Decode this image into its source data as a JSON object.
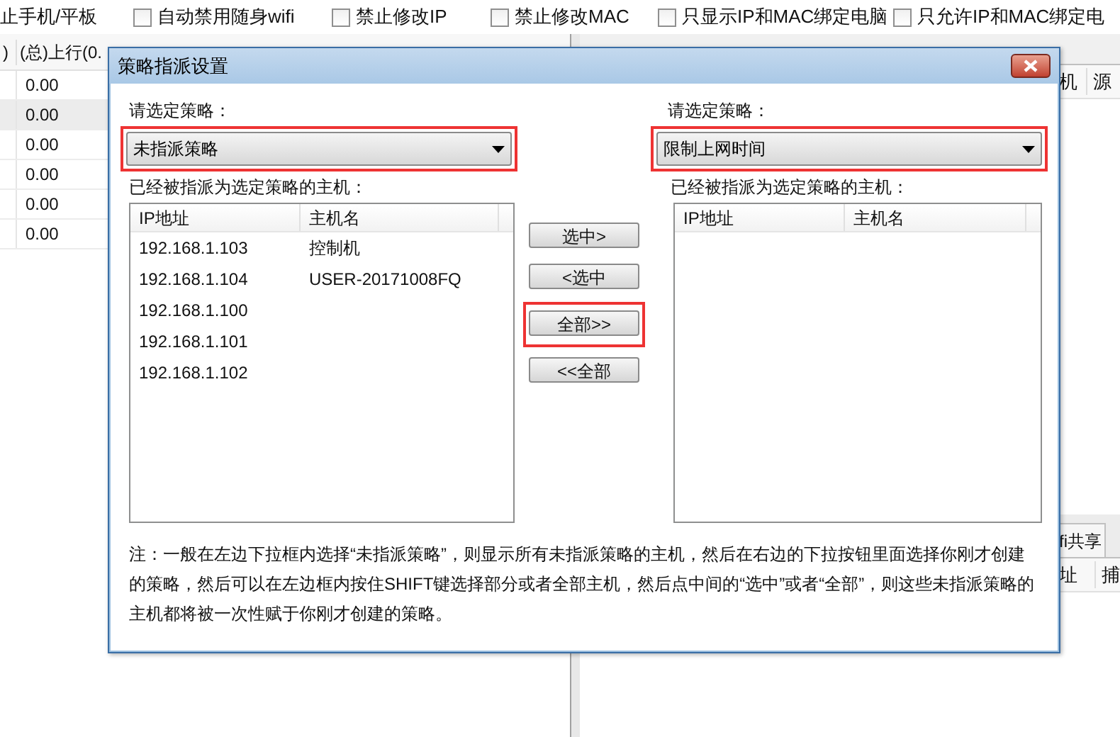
{
  "toolbar": {
    "cut_label": "止手机/平板",
    "checkboxes": [
      {
        "label": "自动禁用随身wifi",
        "checked": false
      },
      {
        "label": "禁止修改IP",
        "checked": false
      },
      {
        "label": "禁止修改MAC",
        "checked": false
      },
      {
        "label": "只显示IP和MAC绑定电脑",
        "checked": false
      },
      {
        "label": "只允许IP和MAC绑定电",
        "checked": false
      }
    ]
  },
  "traffic_table": {
    "columns": [
      ")",
      "(总)上行(0."
    ],
    "rows": [
      {
        "value": "0.00",
        "selected": false
      },
      {
        "value": "0.00",
        "selected": true
      },
      {
        "value": "0.00",
        "selected": false
      },
      {
        "value": "0.00",
        "selected": false
      },
      {
        "value": "0.00",
        "selected": false
      },
      {
        "value": "0.00",
        "selected": false
      }
    ]
  },
  "right_panel": {
    "top_columns": [
      "机",
      "源"
    ],
    "bottom_tab": "fi共享",
    "bottom_columns": [
      "址",
      "捕"
    ]
  },
  "dialog": {
    "title": "策略指派设置",
    "left": {
      "label": "请选定策略：",
      "dropdown": {
        "value": "未指派策略",
        "highlighted": true
      },
      "list_label": "已经被指派为选定策略的主机：",
      "columns": [
        "IP地址",
        "主机名"
      ],
      "rows": [
        [
          "192.168.1.103",
          "控制机"
        ],
        [
          "192.168.1.104",
          "USER-20171008FQ"
        ],
        [
          "192.168.1.100",
          ""
        ],
        [
          "192.168.1.101",
          ""
        ],
        [
          "192.168.1.102",
          ""
        ]
      ]
    },
    "buttons": [
      {
        "label": "选中>",
        "highlighted": false
      },
      {
        "label": "<选中",
        "highlighted": false
      },
      {
        "label": "全部>>",
        "highlighted": true
      },
      {
        "label": "<<全部",
        "highlighted": false
      }
    ],
    "right": {
      "label": "请选定策略：",
      "dropdown": {
        "value": "限制上网时间",
        "highlighted": true
      },
      "list_label": "已经被指派为选定策略的主机：",
      "columns": [
        "IP地址",
        "主机名"
      ]
    },
    "note": "注：一般在左边下拉框内选择“未指派策略”，则显示所有未指派策略的主机，然后在右边的下拉按钮里面选择你刚才创建的策略，然后可以在左边框内按住SHIFT键选择部分或者全部主机，然后点中间的“选中”或者“全部”，则这些未指派策略的主机都将被一次性赋于你刚才创建的策略。"
  }
}
